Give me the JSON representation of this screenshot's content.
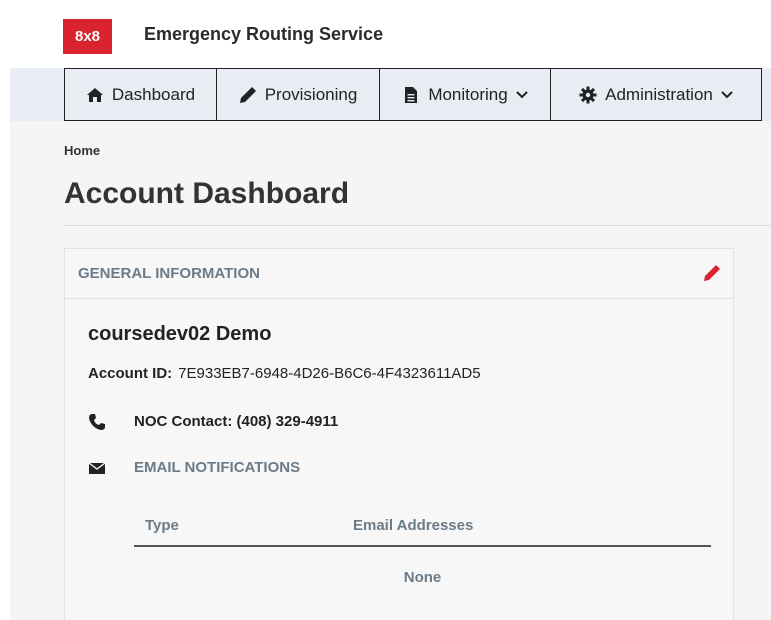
{
  "header": {
    "logo": "8x8",
    "app_title": "Emergency Routing Service"
  },
  "nav": {
    "items": [
      {
        "label": "Dashboard",
        "icon": "home-icon"
      },
      {
        "label": "Provisioning",
        "icon": "pencil-icon"
      },
      {
        "label": "Monitoring",
        "icon": "document-icon",
        "dropdown": true
      },
      {
        "label": "Administration",
        "icon": "gear-icon",
        "dropdown": true
      }
    ]
  },
  "breadcrumb": "Home",
  "page_title": "Account Dashboard",
  "general_info": {
    "title": "GENERAL INFORMATION",
    "account_name": "coursedev02 Demo",
    "account_id_label": "Account ID:",
    "account_id": "7E933EB7-6948-4D26-B6C6-4F4323611AD5",
    "noc_contact": "NOC Contact: (408) 329-4911",
    "email_title": "EMAIL NOTIFICATIONS",
    "table": {
      "columns": [
        "Type",
        "Email Addresses"
      ],
      "empty_text": "None"
    }
  },
  "colors": {
    "brand": "#d9232e",
    "nav_bg": "#e8edf4",
    "muted_heading": "#6b7b88"
  }
}
